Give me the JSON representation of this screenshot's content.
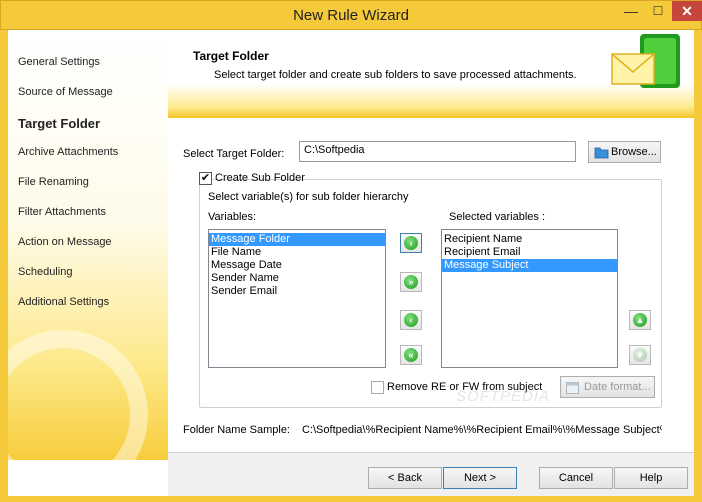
{
  "window": {
    "title": "New Rule Wizard",
    "close_glyph": "✕",
    "minimize_glyph": "—",
    "maximize_glyph": "☐"
  },
  "sidebar": {
    "items": [
      {
        "label": "General Settings"
      },
      {
        "label": "Source of Message"
      },
      {
        "label": "Target Folder",
        "active": true
      },
      {
        "label": "Archive Attachments"
      },
      {
        "label": "File Renaming"
      },
      {
        "label": "Filter Attachments"
      },
      {
        "label": "Action on Message"
      },
      {
        "label": "Scheduling"
      },
      {
        "label": "Additional Settings"
      }
    ]
  },
  "header": {
    "title": "Target Folder",
    "subtitle": "Select target folder and create sub folders to save processed attachments."
  },
  "target": {
    "label": "Select Target Folder:",
    "value": "C:\\Softpedia",
    "browse_label": "Browse..."
  },
  "subfolder": {
    "checkbox_label": "Create Sub Folder",
    "checked": true,
    "hint": "Select variable(s) for sub folder hierarchy",
    "variables_label": "Variables:",
    "selected_label": "Selected variables :",
    "variables": [
      {
        "label": "Message Folder",
        "selected": true
      },
      {
        "label": "File Name"
      },
      {
        "label": "Message Date"
      },
      {
        "label": "Sender Name"
      },
      {
        "label": "Sender Email"
      }
    ],
    "selected_variables": [
      {
        "label": "Recipient Name"
      },
      {
        "label": "Recipient Email"
      },
      {
        "label": "Message Subject",
        "selected": true
      }
    ],
    "remove_re_label": "Remove RE or FW from subject",
    "date_format_label": "Date format..."
  },
  "sample": {
    "label": "Folder Name Sample:",
    "value": "C:\\Softpedia\\%Recipient Name%\\%Recipient Email%\\%Message Subject%"
  },
  "footer": {
    "back_label": "< Back",
    "next_label": "Next >",
    "cancel_label": "Cancel",
    "help_label": "Help"
  },
  "watermark": "SOFTPEDIA",
  "colors": {
    "titlebar": "#f5ca3a",
    "close_button": "#c7463b",
    "selection": "#3399ff",
    "arrow_green": "#1c9a1c"
  },
  "icons": [
    "minimize-icon",
    "maximize-icon",
    "close-icon",
    "folder-icon",
    "envelope-logo-icon",
    "arrow-right-icon",
    "double-arrow-right-icon",
    "arrow-left-icon",
    "double-arrow-left-icon",
    "arrow-up-icon",
    "arrow-down-icon",
    "calendar-icon"
  ]
}
